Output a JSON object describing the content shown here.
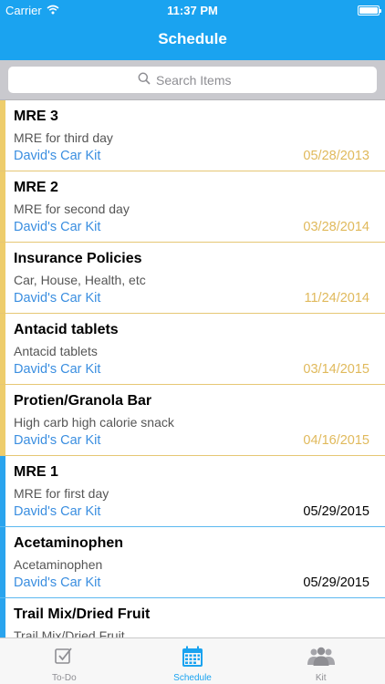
{
  "status": {
    "carrier": "Carrier",
    "time": "11:37 PM"
  },
  "nav": {
    "title": "Schedule"
  },
  "search": {
    "placeholder": "Search Items"
  },
  "items": [
    {
      "title": "MRE 3",
      "description": "MRE for third day",
      "kit": "David's Car Kit",
      "date": "05/28/2013",
      "state": "due"
    },
    {
      "title": "MRE 2",
      "description": "MRE for second day",
      "kit": "David's Car Kit",
      "date": "03/28/2014",
      "state": "due"
    },
    {
      "title": "Insurance Policies",
      "description": "Car, House, Health, etc",
      "kit": "David's Car Kit",
      "date": "11/24/2014",
      "state": "due"
    },
    {
      "title": "Antacid tablets",
      "description": "Antacid tablets",
      "kit": "David's Car Kit",
      "date": "03/14/2015",
      "state": "due"
    },
    {
      "title": "Protien/Granola Bar",
      "description": "High carb high calorie snack",
      "kit": "David's Car Kit",
      "date": "04/16/2015",
      "state": "due"
    },
    {
      "title": "MRE 1",
      "description": "MRE for first day",
      "kit": "David's Car Kit",
      "date": "05/29/2015",
      "state": "future"
    },
    {
      "title": "Acetaminophen",
      "description": "Acetaminophen",
      "kit": "David's Car Kit",
      "date": "05/29/2015",
      "state": "future"
    },
    {
      "title": "Trail Mix/Dried Fruit",
      "description": "Trail Mix/Dried Fruit",
      "kit": "",
      "date": "",
      "state": "future"
    }
  ],
  "tabs": [
    {
      "label": "To-Do",
      "icon": "checkbox-icon",
      "active": false
    },
    {
      "label": "Schedule",
      "icon": "calendar-icon",
      "active": true
    },
    {
      "label": "Kit",
      "icon": "people-icon",
      "active": false
    }
  ],
  "colors": {
    "accent": "#1aa3f0",
    "due_bar": "#eecd6c",
    "due_date": "#e0b95b",
    "future_bar": "#2aa4ee",
    "kit_link": "#3a8ee0"
  }
}
